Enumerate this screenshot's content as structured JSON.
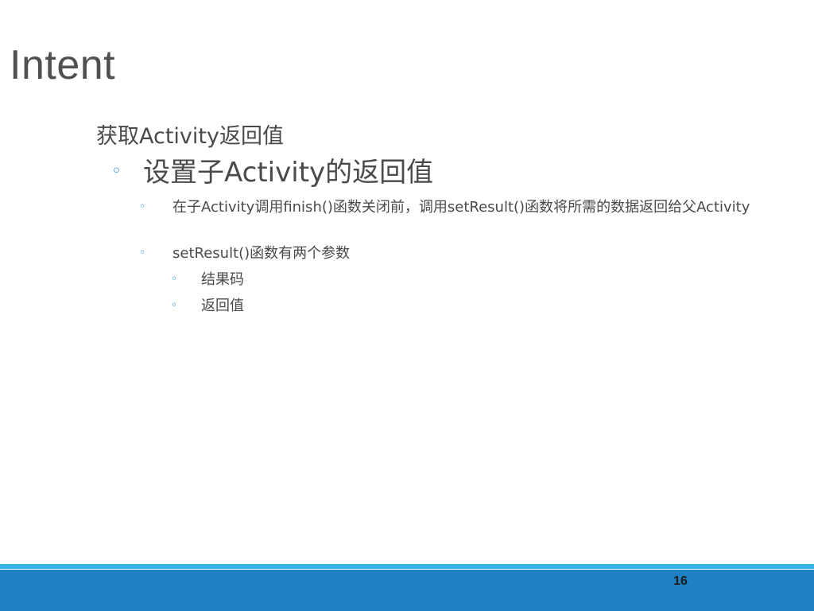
{
  "slide": {
    "title": "Intent",
    "heading": "获取Activity返回值",
    "subheading": "设置子Activity的返回值",
    "bullet_symbol": "◦",
    "items": [
      {
        "text": "在子Activity调用finish()函数关闭前，调用setResult()函数将所需的数据返回给父Activity"
      },
      {
        "text": "setResult()函数有两个参数"
      }
    ],
    "params": [
      {
        "text": "结果码"
      },
      {
        "text": "返回值"
      }
    ],
    "page_number": "16"
  },
  "colors": {
    "accent": "#1f8dd6",
    "footer_line": "#34b2e4",
    "footer_bar": "#1e81c3",
    "text": "#4a4a4a"
  }
}
